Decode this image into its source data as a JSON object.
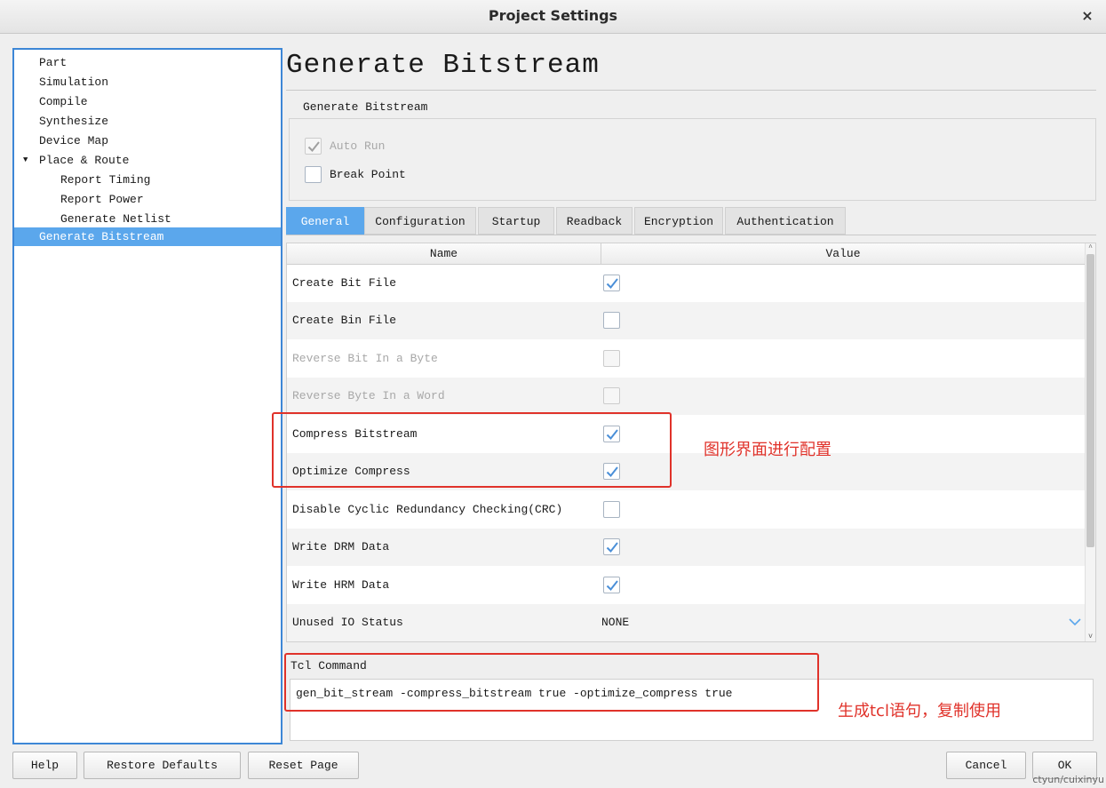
{
  "window": {
    "title": "Project Settings",
    "close_glyph": "×"
  },
  "sidebar": {
    "items": [
      {
        "label": "Part"
      },
      {
        "label": "Simulation"
      },
      {
        "label": "Compile"
      },
      {
        "label": "Synthesize"
      },
      {
        "label": "Device Map"
      },
      {
        "label": "Place & Route",
        "expanded": true
      },
      {
        "label": "Report Timing"
      },
      {
        "label": "Report Power"
      },
      {
        "label": "Generate Netlist"
      },
      {
        "label": "Generate Bitstream",
        "selected": true
      }
    ]
  },
  "main": {
    "title": "Generate Bitstream",
    "group": {
      "label": "Generate Bitstream",
      "auto_run": {
        "label": "Auto Run",
        "checked": true,
        "disabled": true
      },
      "break_point": {
        "label": "Break Point",
        "checked": false
      }
    },
    "tabs": [
      {
        "label": "General",
        "active": true
      },
      {
        "label": "Configuration"
      },
      {
        "label": "Startup"
      },
      {
        "label": "Readback"
      },
      {
        "label": "Encryption"
      },
      {
        "label": "Authentication"
      }
    ],
    "table": {
      "headers": {
        "name": "Name",
        "value": "Value"
      },
      "rows": [
        {
          "name": "Create Bit File",
          "checked": true
        },
        {
          "name": "Create Bin File",
          "checked": false
        },
        {
          "name": "Reverse Bit In a Byte",
          "checked": false,
          "disabled": true
        },
        {
          "name": "Reverse Byte In a Word",
          "checked": false,
          "disabled": true
        },
        {
          "name": "Compress Bitstream",
          "checked": true
        },
        {
          "name": "Optimize Compress",
          "checked": true
        },
        {
          "name": "Disable Cyclic Redundancy Checking(CRC)",
          "checked": false
        },
        {
          "name": "Write DRM Data",
          "checked": true
        },
        {
          "name": "Write HRM Data",
          "checked": true
        },
        {
          "name": "Unused IO Status",
          "value": "NONE"
        }
      ]
    },
    "tcl": {
      "label": "Tcl Command",
      "command": "gen_bit_stream -compress_bitstream true -optimize_compress true"
    }
  },
  "buttons": {
    "help": "Help",
    "restore_defaults": "Restore Defaults",
    "reset_page": "Reset Page",
    "cancel": "Cancel",
    "ok": "OK"
  },
  "annotations": {
    "gui_config": "图形界面进行配置",
    "tcl_note": "生成tcl语句，复制使用"
  },
  "credit": "ctyun/cuixinyu",
  "colors": {
    "accent": "#5ba7ec",
    "annotation": "#e0322a",
    "check": "#4a8fd8"
  }
}
